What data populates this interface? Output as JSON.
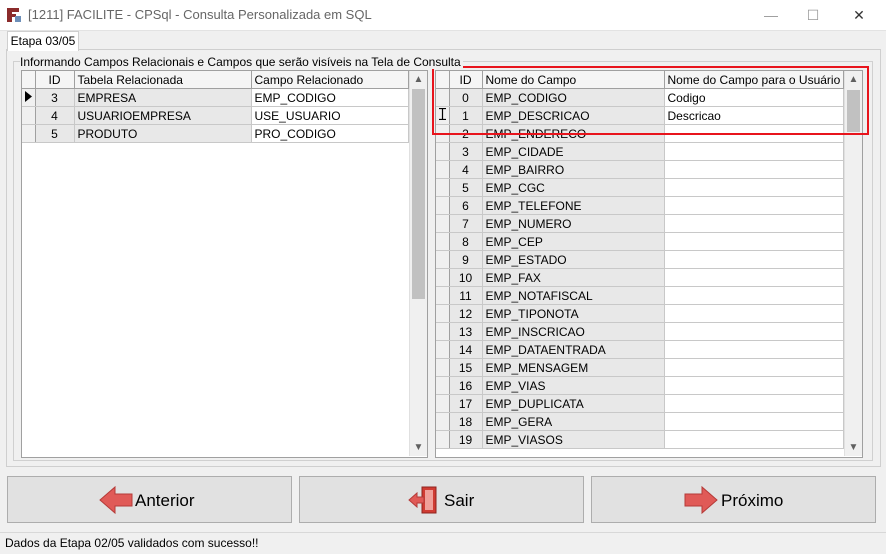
{
  "window": {
    "title": "[1211] FACILITE - CPSql - Consulta Personalizada em SQL",
    "minimize_label": "—",
    "maximize_label": "☐",
    "close_label": "✕"
  },
  "tab": {
    "label": "Etapa 03/05"
  },
  "group": {
    "label": "Informando Campos Relacionais e Campos que serão visíveis na Tela de Consulta"
  },
  "left_grid": {
    "headers": [
      "ID",
      "Tabela Relacionada",
      "Campo Relacionado"
    ],
    "rows": [
      {
        "id": "3",
        "tabela": "EMPRESA",
        "campo": "EMP_CODIGO",
        "current": true
      },
      {
        "id": "4",
        "tabela": "USUARIOEMPRESA",
        "campo": "USE_USUARIO"
      },
      {
        "id": "5",
        "tabela": "PRODUTO",
        "campo": "PRO_CODIGO"
      }
    ]
  },
  "right_grid": {
    "headers": [
      "ID",
      "Nome do Campo",
      "Nome do Campo para o Usuário"
    ],
    "rows": [
      {
        "id": "0",
        "nome": "EMP_CODIGO",
        "usuario": "Codigo"
      },
      {
        "id": "1",
        "nome": "EMP_DESCRICAO",
        "usuario": "Descricao",
        "editing": true
      },
      {
        "id": "2",
        "nome": "EMP_ENDERECO",
        "usuario": ""
      },
      {
        "id": "3",
        "nome": "EMP_CIDADE",
        "usuario": ""
      },
      {
        "id": "4",
        "nome": "EMP_BAIRRO",
        "usuario": ""
      },
      {
        "id": "5",
        "nome": "EMP_CGC",
        "usuario": ""
      },
      {
        "id": "6",
        "nome": "EMP_TELEFONE",
        "usuario": ""
      },
      {
        "id": "7",
        "nome": "EMP_NUMERO",
        "usuario": ""
      },
      {
        "id": "8",
        "nome": "EMP_CEP",
        "usuario": ""
      },
      {
        "id": "9",
        "nome": "EMP_ESTADO",
        "usuario": ""
      },
      {
        "id": "10",
        "nome": "EMP_FAX",
        "usuario": ""
      },
      {
        "id": "11",
        "nome": "EMP_NOTAFISCAL",
        "usuario": ""
      },
      {
        "id": "12",
        "nome": "EMP_TIPONOTA",
        "usuario": ""
      },
      {
        "id": "13",
        "nome": "EMP_INSCRICAO",
        "usuario": ""
      },
      {
        "id": "14",
        "nome": "EMP_DATAENTRADA",
        "usuario": ""
      },
      {
        "id": "15",
        "nome": "EMP_MENSAGEM",
        "usuario": ""
      },
      {
        "id": "16",
        "nome": "EMP_VIAS",
        "usuario": ""
      },
      {
        "id": "17",
        "nome": "EMP_DUPLICATA",
        "usuario": ""
      },
      {
        "id": "18",
        "nome": "EMP_GERA",
        "usuario": ""
      },
      {
        "id": "19",
        "nome": "EMP_VIASOS",
        "usuario": ""
      }
    ]
  },
  "buttons": {
    "anterior": "Anterior",
    "sair": "Sair",
    "proximo": "Próximo"
  },
  "icons": {
    "back": "arrow-left-icon",
    "exit": "exit-door-icon",
    "next": "arrow-right-icon",
    "arrow_color": "#e05a57",
    "door_color": "#d03b33"
  },
  "status": {
    "text": "Dados da Etapa 02/05 validados com sucesso!!"
  }
}
